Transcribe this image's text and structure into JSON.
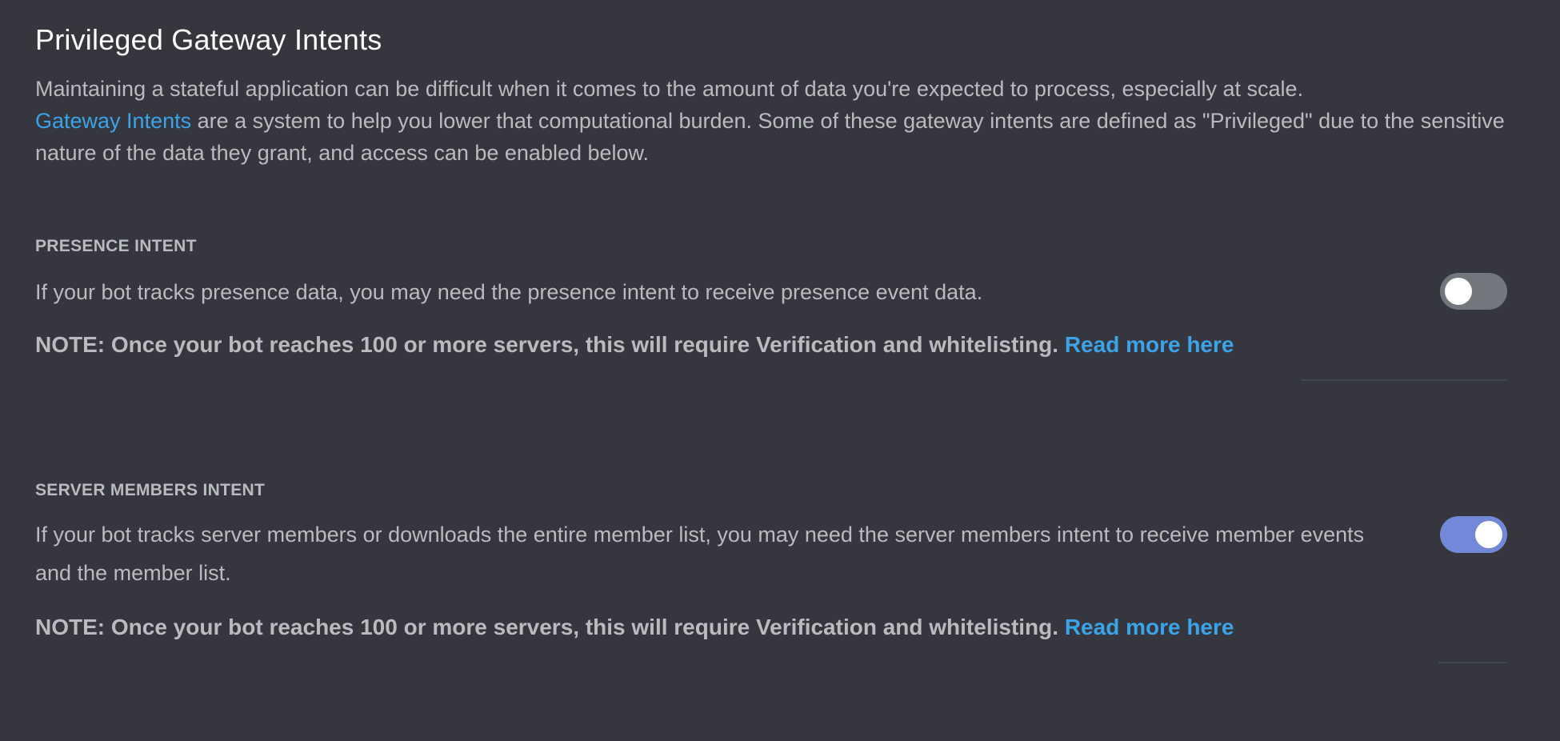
{
  "title": "Privileged Gateway Intents",
  "intro": {
    "text_before": "Maintaining a stateful application can be difficult when it comes to the amount of data you're expected to process, especially at scale.",
    "link": "Gateway Intents",
    "text_after": "are a system to help you lower that computational burden. Some of these gateway intents are defined as \"Privileged\" due to the sensitive nature of the data they grant, and access can be enabled below."
  },
  "intents": [
    {
      "title": "PRESENCE INTENT",
      "description": "If your bot tracks presence data, you may need the presence intent to receive presence event data.",
      "note": "NOTE: Once your bot reaches 100 or more servers, this will require Verification and whitelisting.",
      "link": "Read more here",
      "enabled": false
    },
    {
      "title": "SERVER MEMBERS INTENT",
      "description": "If your bot tracks server members or downloads the entire member list, you may need the server members intent to receive member events and the member list.",
      "note": "NOTE: Once your bot reaches 100 or more servers, this will require Verification and whitelisting.",
      "link": "Read more here",
      "enabled": true
    }
  ],
  "colors": {
    "background": "#36373e",
    "link": "#3ba3e8",
    "toggle_on": "#7289da",
    "toggle_off": "#72767d"
  }
}
